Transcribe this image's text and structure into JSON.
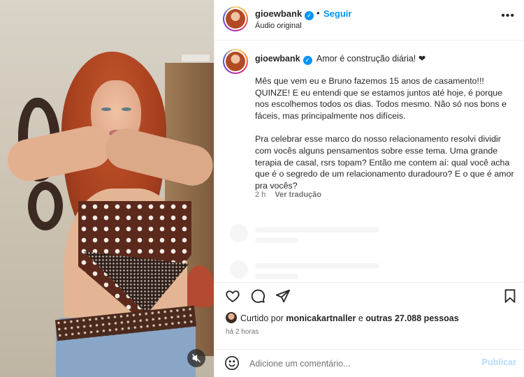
{
  "post": {
    "username": "gioewbank",
    "follow_label": "Seguir",
    "separator": "•",
    "audio_label": "Áudio original",
    "more_label": "•••"
  },
  "caption": {
    "username": "gioewbank",
    "headline": "Amor é construção diária! ❤",
    "paragraph1": "Mês que vem eu e Bruno fazemos 15 anos de casamento!!! QUINZE! E eu entendi que se estamos juntos até hoje, é porque nos escolhemos todos os dias. Todos mesmo. Não só nos bons e fáceis, mas principalmente nos difíceis.",
    "paragraph2": "Pra celebrar esse marco do nosso relacionamento resolvi dividir com vocês alguns pensamentos sobre esse tema. Uma grande terapia de casal, rsrs topam? Então me contem aí: qual você acha que é o segredo de um relacionamento duradouro? E o que é amor pra vocês?",
    "age": "2 h",
    "translate_label": "Ver tradução"
  },
  "likes": {
    "prefix": "Curtido por",
    "user": "monicakartnaller",
    "connector": "e",
    "others": "outras 27.088 pessoas",
    "time": "há 2 horas"
  },
  "comment": {
    "placeholder": "Adicione um comentário...",
    "publish_label": "Publicar"
  },
  "icons": {
    "heart": "heart-icon",
    "comment": "comment-icon",
    "share": "share-icon",
    "save": "bookmark-icon",
    "emoji": "emoji-icon",
    "mute": "muted-speaker-icon",
    "verified": "verified-badge-icon",
    "more": "more-options-icon"
  },
  "colors": {
    "accent": "#0095f6",
    "publish_disabled": "#b3dbff",
    "muted_text": "#737373"
  }
}
